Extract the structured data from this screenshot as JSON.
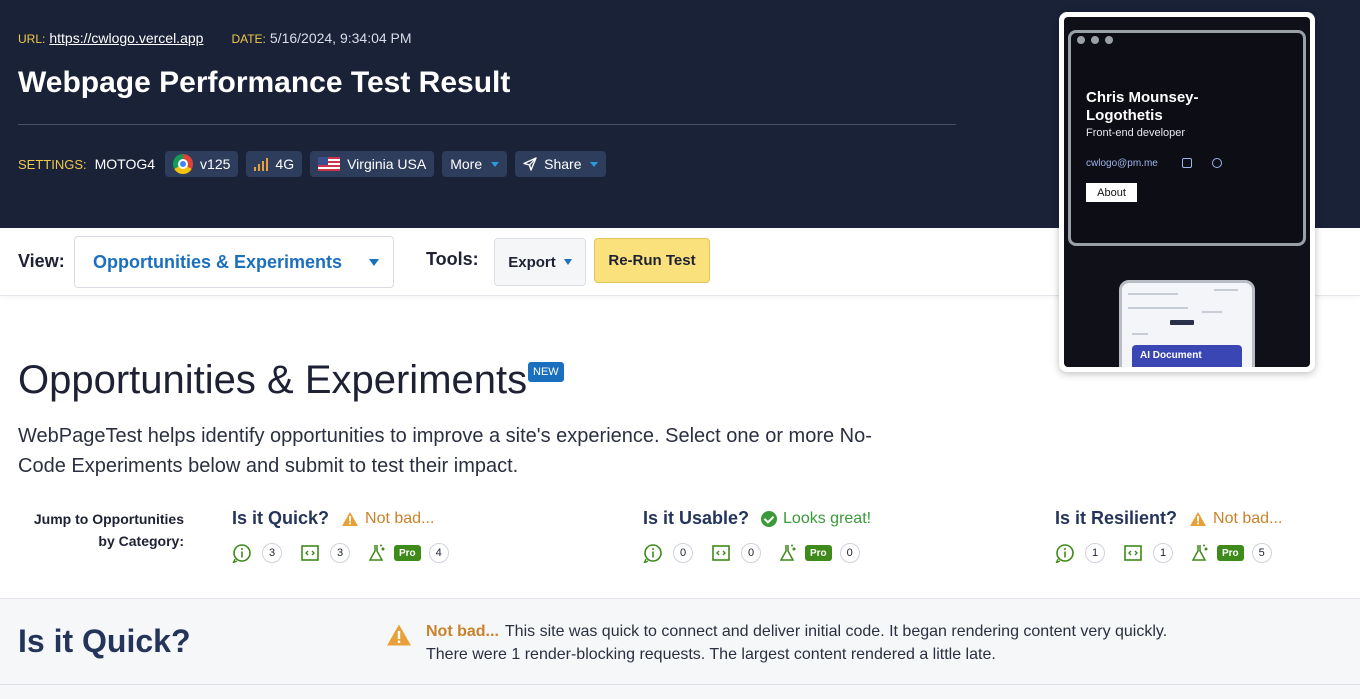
{
  "header": {
    "url_label": "URL:",
    "url": "https://cwlogo.vercel.app",
    "date_label": "DATE:",
    "date": "5/16/2024, 9:34:04 PM",
    "title": "Webpage Performance Test Result",
    "settings_label": "SETTINGS:",
    "device": "MOTOG4",
    "browser": {
      "icon": "chrome-icon",
      "label": "v125"
    },
    "connection": {
      "icon": "signal-icon",
      "label": "4G"
    },
    "location": {
      "icon": "us-flag-icon",
      "label": "Virginia USA"
    },
    "more_label": "More",
    "share_label": "Share"
  },
  "toolbar": {
    "view_label": "View:",
    "view_value": "Opportunities & Experiments",
    "tools_label": "Tools:",
    "export_label": "Export",
    "rerun_label": "Re-Run Test"
  },
  "preview": {
    "name": "Chris Mounsey-Logothetis",
    "role": "Front-end developer",
    "email": "cwlogo@pm.me",
    "about": "About",
    "mobile_card": "AI Document"
  },
  "main": {
    "title": "Opportunities & Experiments",
    "badge": "NEW",
    "description": "WebPageTest helps identify opportunities to improve a site's experience. Select one or more No-Code Experiments below and submit to test their impact.",
    "jump_label_1": "Jump to Opportunities",
    "jump_label_2": "by Category:",
    "categories": [
      {
        "title": "Is it Quick?",
        "status": "Not bad...",
        "status_type": "warning",
        "observations": "3",
        "tips": "3",
        "pro_label": "Pro",
        "experiments": "4"
      },
      {
        "title": "Is it Usable?",
        "status": "Looks great!",
        "status_type": "good",
        "observations": "0",
        "tips": "0",
        "pro_label": "Pro",
        "experiments": "0"
      },
      {
        "title": "Is it Resilient?",
        "status": "Not bad...",
        "status_type": "warning",
        "observations": "1",
        "tips": "1",
        "pro_label": "Pro",
        "experiments": "5"
      }
    ]
  },
  "quick_section": {
    "title": "Is it Quick?",
    "status": "Not bad...",
    "summary_1": "This site was quick to connect and deliver initial code. It began rendering content very quickly.",
    "summary_2": "There were 1 render-blocking requests. The largest content rendered a little late."
  },
  "colors": {
    "header_bg": "#1a2238",
    "accent_yellow": "#f0c94a",
    "link_blue": "#1b6fbf",
    "warning": "#c9822a",
    "good": "#3a9a3a",
    "pro_green": "#3e8a1a",
    "rerun_bg": "#fbe17b"
  }
}
